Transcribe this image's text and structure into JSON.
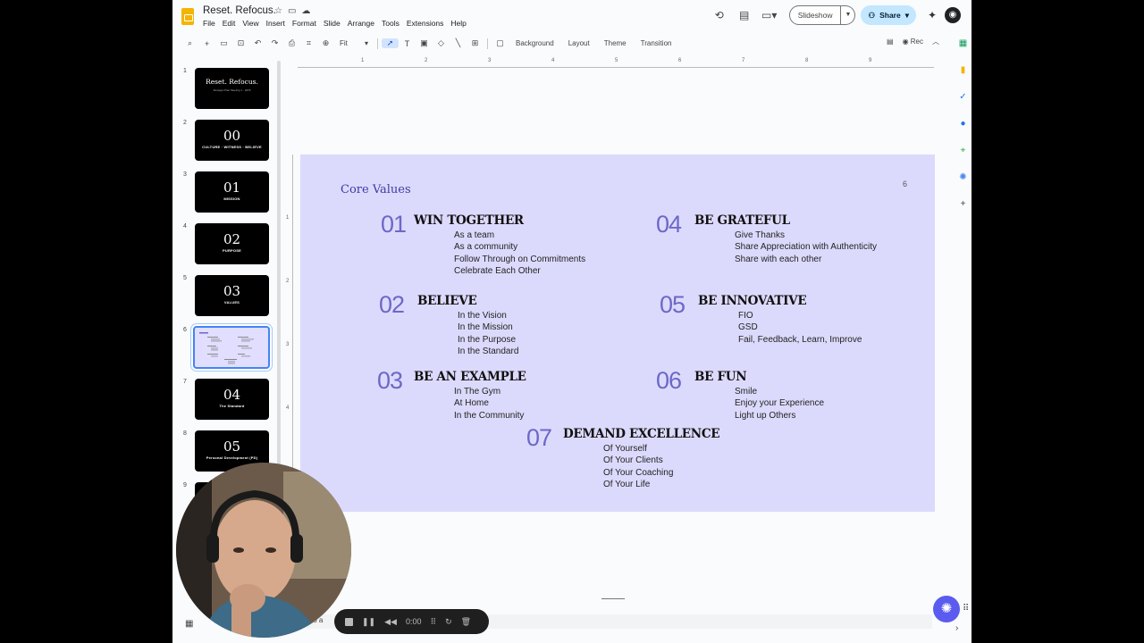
{
  "header": {
    "doc_title": "Reset. Refocus.",
    "menu": [
      "File",
      "Edit",
      "View",
      "Insert",
      "Format",
      "Slide",
      "Arrange",
      "Tools",
      "Extensions",
      "Help"
    ],
    "slideshow_label": "Slideshow",
    "share_label": "Share"
  },
  "toolbar": {
    "zoom_label": "Fit",
    "background_label": "Background",
    "layout_label": "Layout",
    "theme_label": "Theme",
    "transition_label": "Transition",
    "rec_label": "Rec"
  },
  "rulers": {
    "h": [
      "1",
      "2",
      "3",
      "4",
      "5",
      "6",
      "7",
      "8",
      "9"
    ],
    "v": [
      "1",
      "2",
      "3",
      "4"
    ]
  },
  "filmstrip": [
    {
      "num": "1",
      "title": "Reset. Refocus.",
      "sub": "Strategic Plan Meeting 1 · 2025",
      "kind": "title"
    },
    {
      "num": "2",
      "big": "00",
      "small": "CULTURE · WITNESS · BELIEVE",
      "kind": "section"
    },
    {
      "num": "3",
      "big": "01",
      "small": "MISSION",
      "kind": "section"
    },
    {
      "num": "4",
      "big": "02",
      "small": "PURPOSE",
      "kind": "section"
    },
    {
      "num": "5",
      "big": "03",
      "small": "VALUES",
      "kind": "section"
    },
    {
      "num": "6",
      "kind": "active"
    },
    {
      "num": "7",
      "big": "04",
      "small": "The Standard",
      "kind": "section"
    },
    {
      "num": "8",
      "big": "05",
      "small": "Personal Development (PD)",
      "kind": "section"
    },
    {
      "num": "9",
      "kind": "partial"
    }
  ],
  "slide": {
    "title": "Core Values",
    "page_number": "6",
    "values": [
      {
        "num": "01",
        "heading": "WIN TOGETHER",
        "items": [
          "As a team",
          "As a community",
          "Follow Through on Commitments",
          "Celebrate Each Other"
        ]
      },
      {
        "num": "04",
        "heading": "BE GRATEFUL",
        "items": [
          "Give Thanks",
          "Share Appreciation with Authenticity",
          "Share with each other"
        ]
      },
      {
        "num": "02",
        "heading": "BELIEVE",
        "items": [
          "In the Vision",
          "In the Mission",
          "In the Purpose",
          "In the Standard"
        ]
      },
      {
        "num": "05",
        "heading": "BE INNOVATIVE",
        "items": [
          "FIO",
          "GSD",
          "Fail, Feedback, Learn, Improve"
        ]
      },
      {
        "num": "03",
        "heading": "BE AN EXAMPLE",
        "items": [
          "In The Gym",
          "At Home",
          "In the Community"
        ]
      },
      {
        "num": "06",
        "heading": "BE FUN",
        "items": [
          "Smile",
          "Enjoy your Experience",
          "Light up Others"
        ]
      },
      {
        "num": "07",
        "heading": "DEMAND EXCELLENCE",
        "items": [
          "Of Yourself",
          "Of Your Clients",
          "Of Your Coaching",
          "Of Your Life"
        ]
      }
    ]
  },
  "recorder": {
    "time": "0:00"
  },
  "bottom_text": "to a"
}
